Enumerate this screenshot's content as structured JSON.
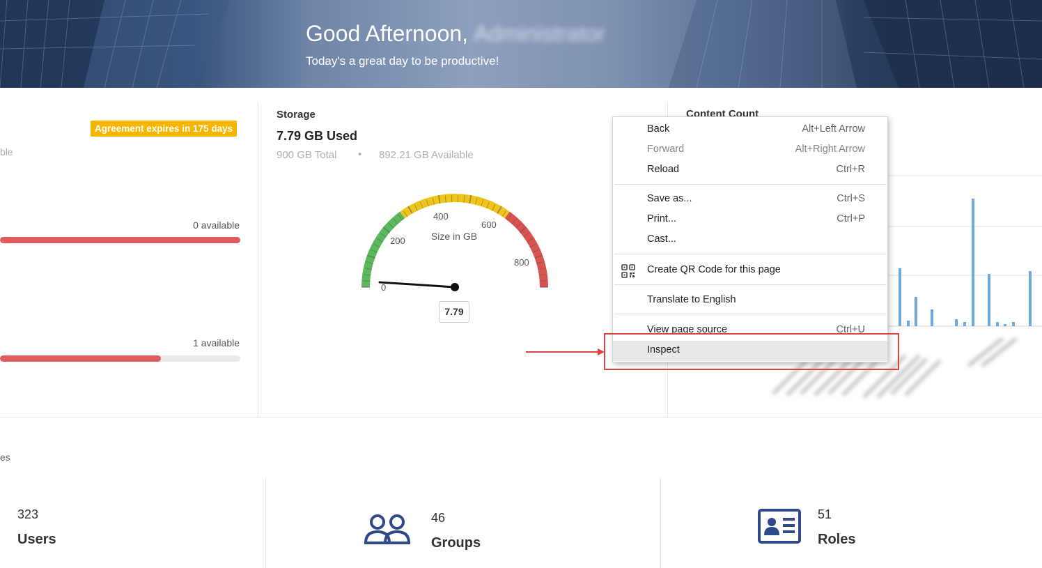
{
  "banner": {
    "greeting": "Good Afternoon,",
    "user_name": "Administrator",
    "subtitle": "Today's a great day to be productive!"
  },
  "agreement": {
    "badge": "Agreement expires in 175 days",
    "partial_label": "ble",
    "rows": [
      {
        "available": "0 available",
        "fill_fraction": 1.0
      },
      {
        "available": "1 available",
        "fill_fraction": 0.67
      }
    ]
  },
  "storage": {
    "label": "Storage",
    "used": "7.79 GB Used",
    "total": "900 GB Total",
    "separator": "•",
    "available": "892.21 GB Available",
    "gauge": {
      "title": "Size in GB",
      "value": 7.79,
      "value_label": "7.79",
      "min": 0,
      "max": 900,
      "ticks": [
        "0",
        "200",
        "400",
        "600",
        "800"
      ],
      "colors": {
        "low": "#5cb85c",
        "mid": "#f0c419",
        "high": "#d9534f"
      }
    }
  },
  "content_count": {
    "title": "Content Count",
    "bar_color": "#6fa8dc"
  },
  "bottom": {
    "partial_label": "es",
    "stats": [
      {
        "count": "323",
        "label": "Users",
        "icon": "user-icon"
      },
      {
        "count": "46",
        "label": "Groups",
        "icon": "groups-icon"
      },
      {
        "count": "51",
        "label": "Roles",
        "icon": "id-card-icon"
      }
    ],
    "icon_color": "#2e4a8b"
  },
  "context_menu": {
    "items": [
      {
        "label": "Back",
        "shortcut": "Alt+Left Arrow"
      },
      {
        "label": "Forward",
        "shortcut": "Alt+Right Arrow"
      },
      {
        "label": "Reload",
        "shortcut": "Ctrl+R"
      },
      {
        "label": "Save as...",
        "shortcut": "Ctrl+S"
      },
      {
        "label": "Print...",
        "shortcut": "Ctrl+P"
      },
      {
        "label": "Cast...",
        "shortcut": ""
      },
      {
        "label": "Create QR Code for this page",
        "shortcut": ""
      },
      {
        "label": "Translate to English",
        "shortcut": ""
      },
      {
        "label": "View page source",
        "shortcut": "Ctrl+U"
      },
      {
        "label": "Inspect",
        "shortcut": ""
      }
    ],
    "highlight_color": "#e2423f"
  }
}
